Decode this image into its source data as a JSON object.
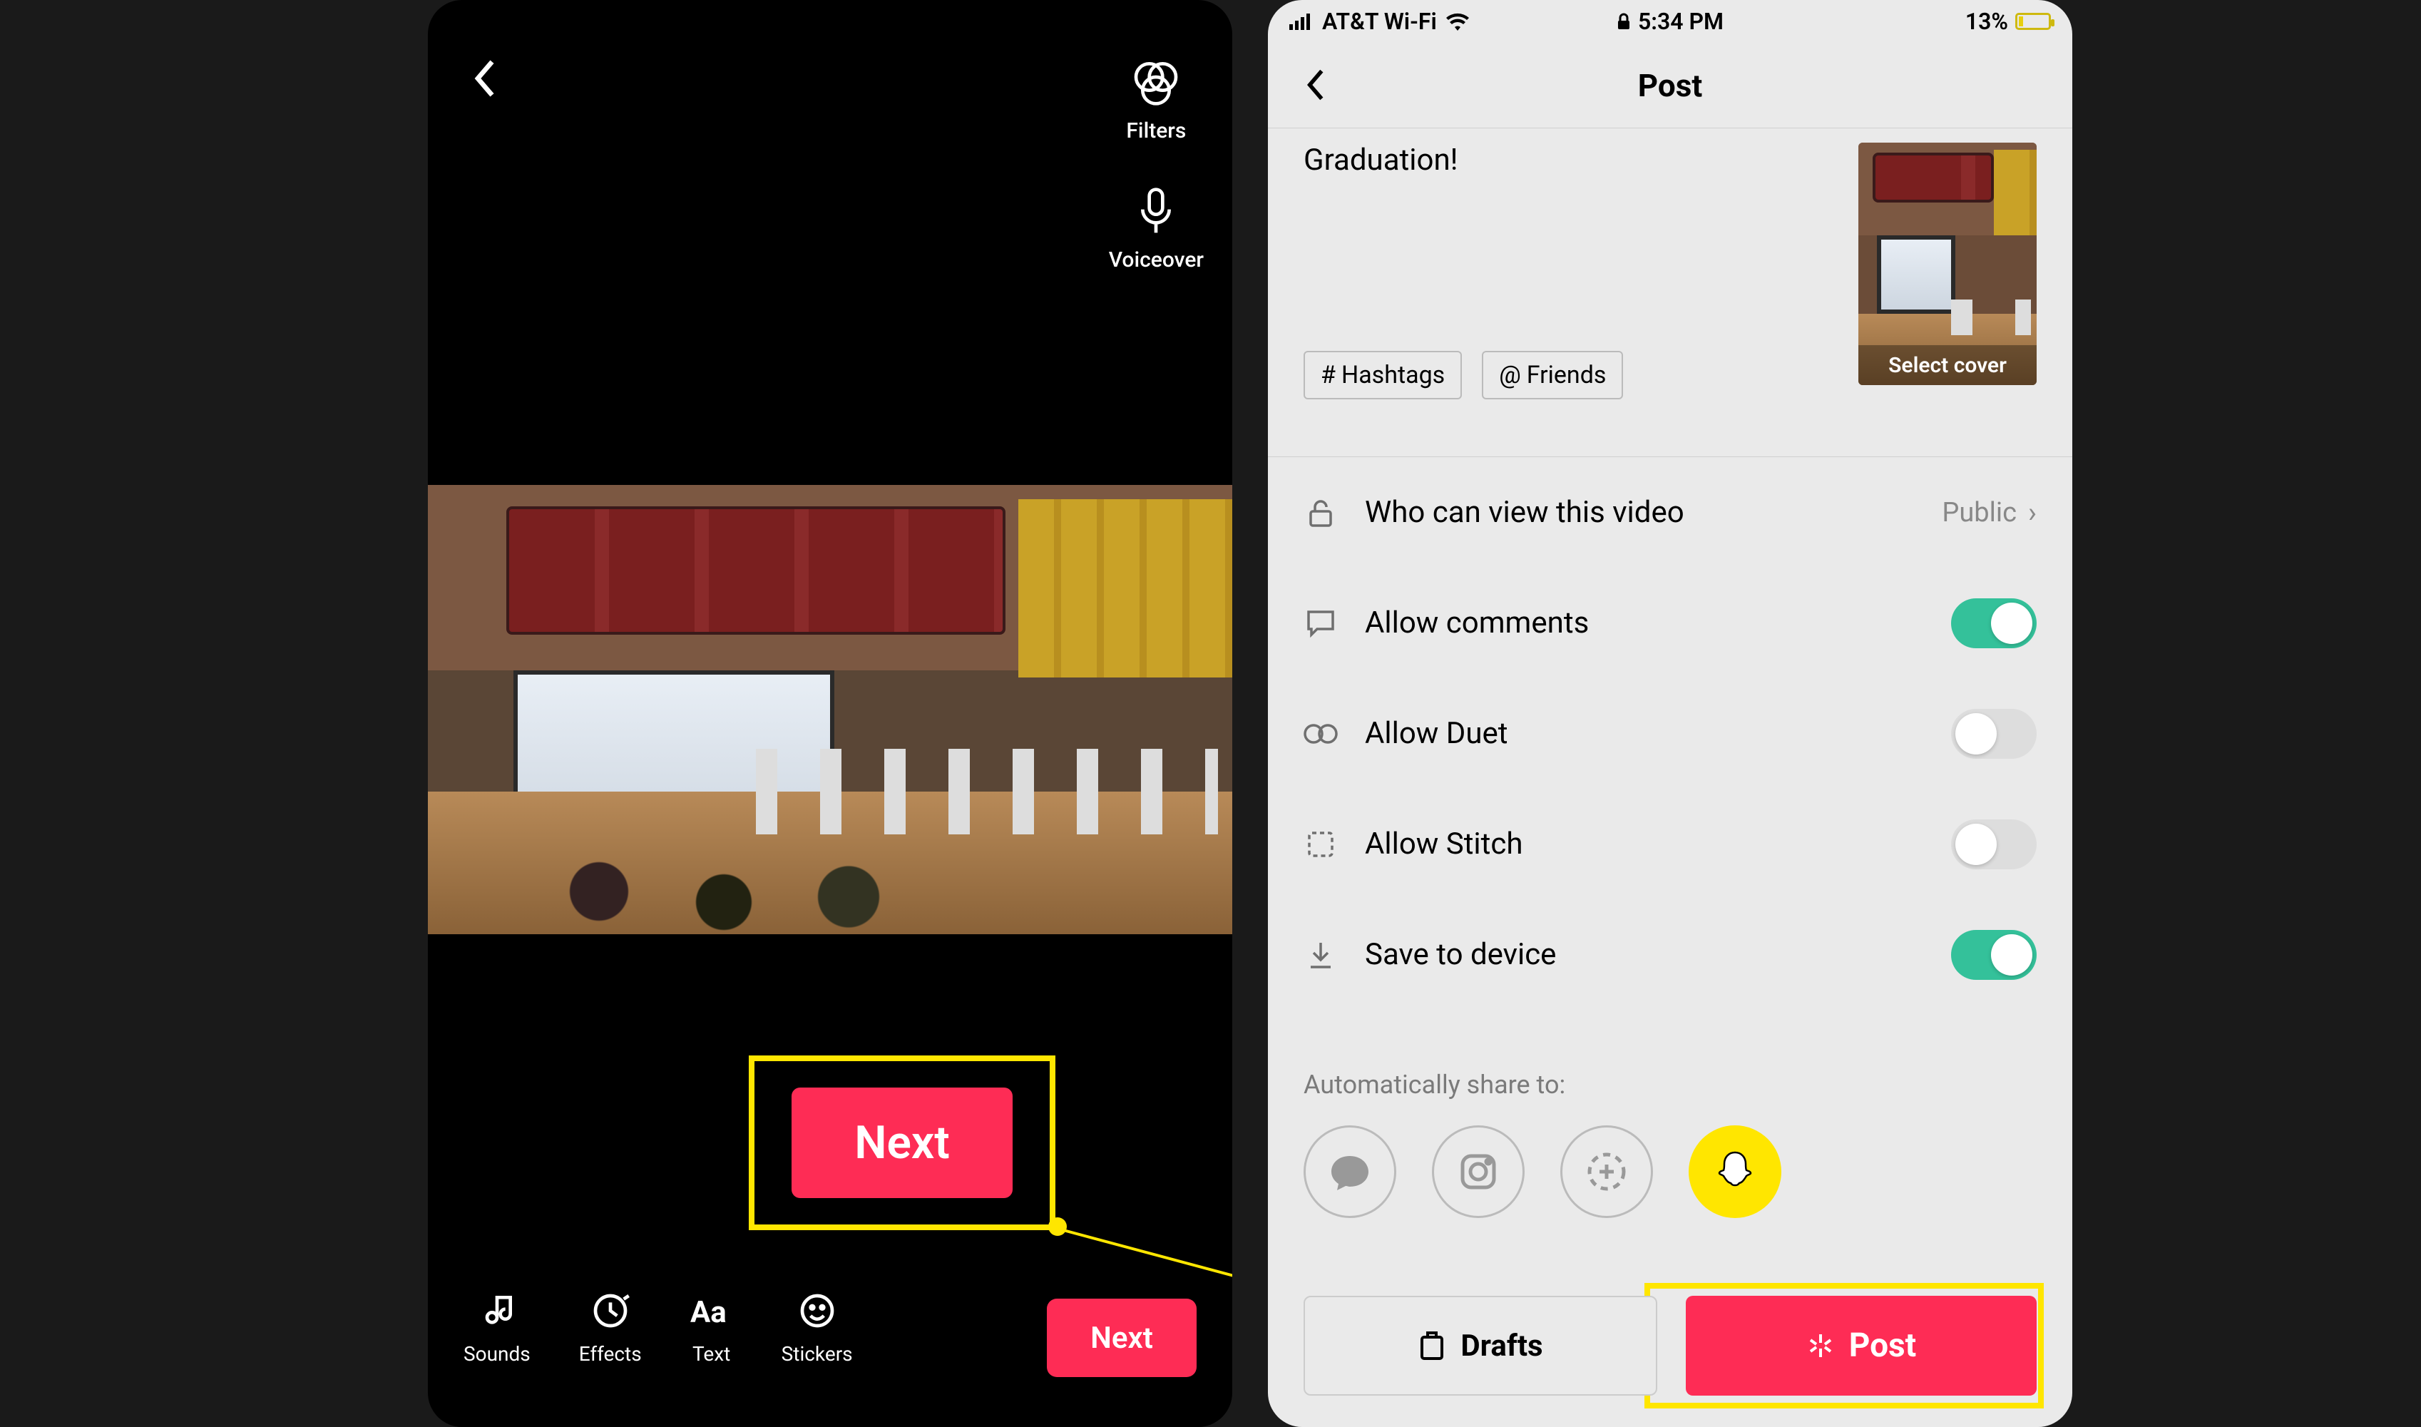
{
  "editor": {
    "right_tools": {
      "filters": "Filters",
      "voiceover": "Voiceover"
    },
    "highlight_button": "Next",
    "bottom_tools": {
      "sounds": "Sounds",
      "effects": "Effects",
      "text": "Text",
      "stickers": "Stickers"
    },
    "next_small": "Next"
  },
  "status": {
    "carrier": "AT&T Wi-Fi",
    "time": "5:34 PM",
    "battery_pct": "13%"
  },
  "post": {
    "header": "Post",
    "caption": "Graduation!",
    "hashtags_btn": "Hashtags",
    "friends_btn": "Friends",
    "cover_label": "Select cover",
    "settings": {
      "view": {
        "title": "Who can view this video",
        "value": "Public"
      },
      "comments": {
        "title": "Allow comments",
        "on": true
      },
      "duet": {
        "title": "Allow Duet",
        "on": false
      },
      "stitch": {
        "title": "Allow Stitch",
        "on": false
      },
      "save": {
        "title": "Save to device",
        "on": true
      }
    },
    "share_label": "Automatically share to:",
    "drafts_btn": "Drafts",
    "post_btn": "Post"
  }
}
